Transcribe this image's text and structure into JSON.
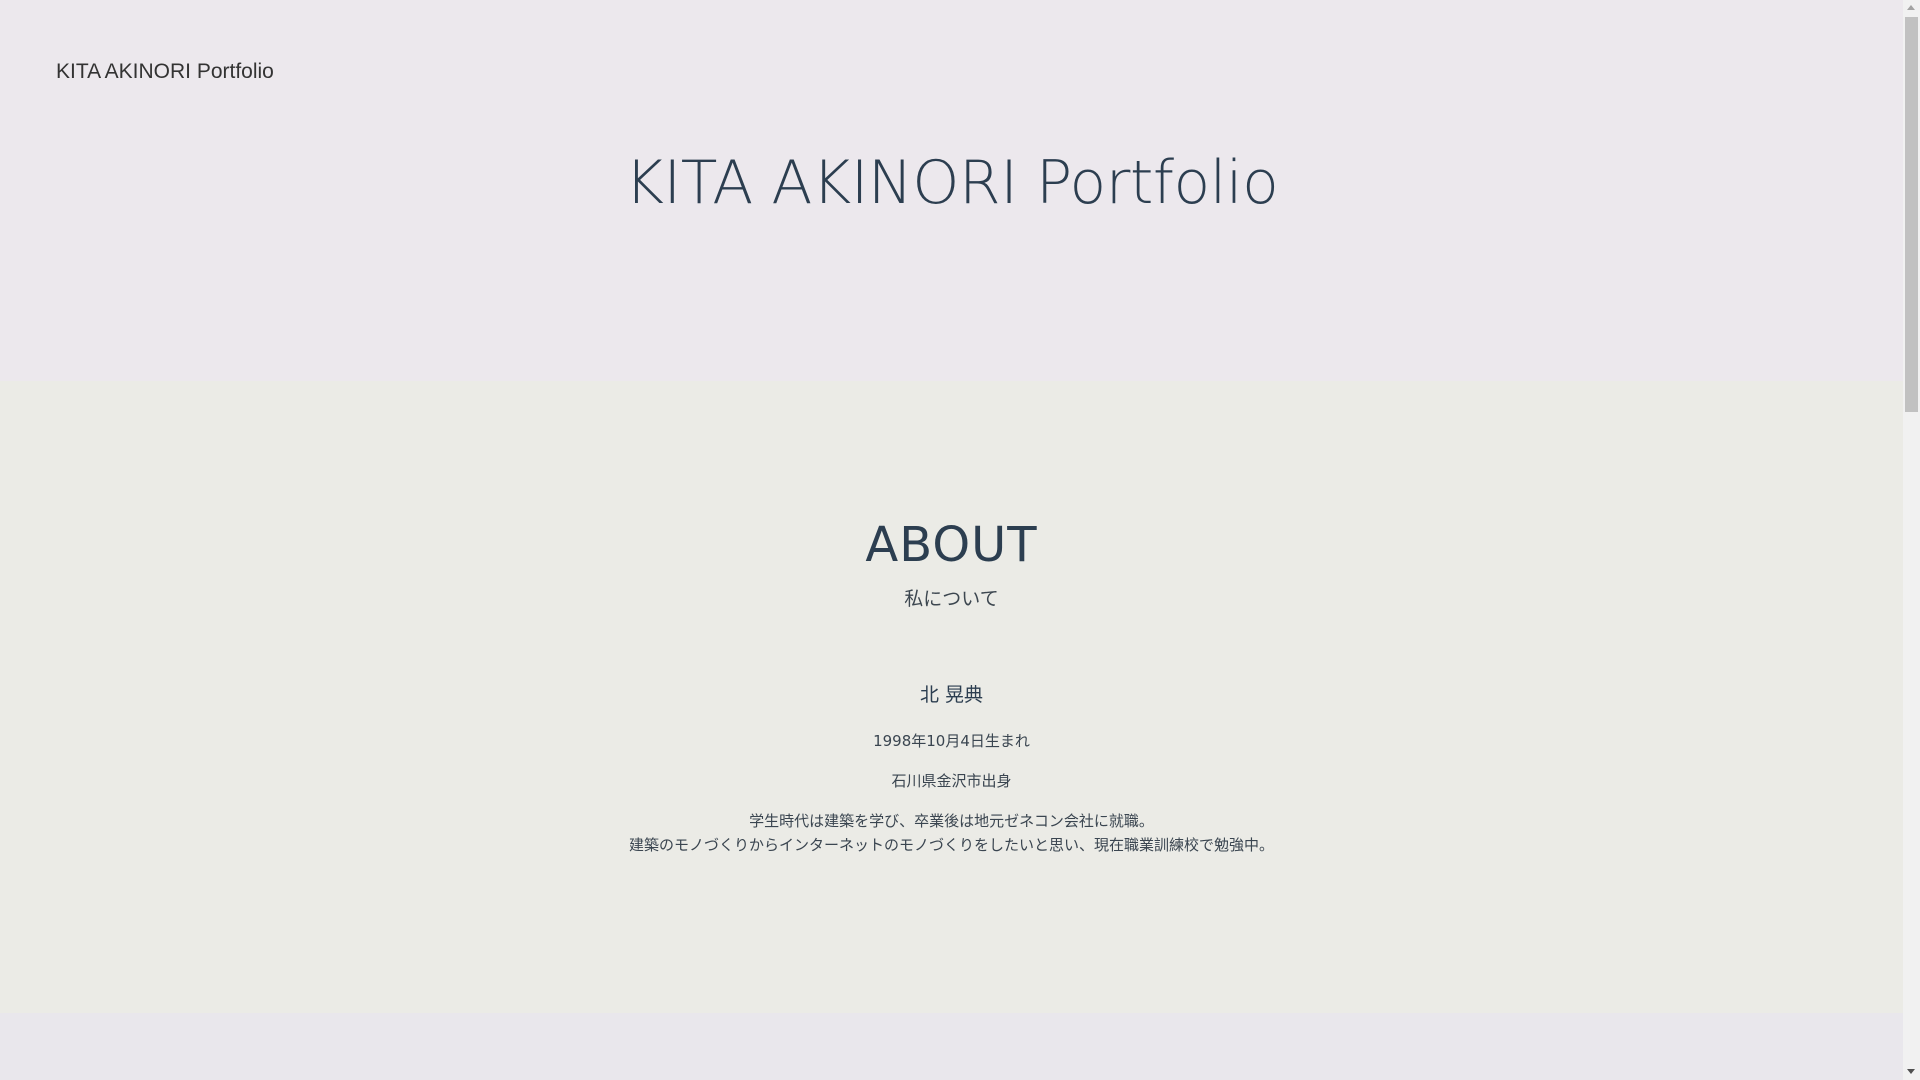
{
  "header": {
    "logo": "KITA AKINORI Portfolio"
  },
  "hero": {
    "title": "KITA AKINORI Portfolio"
  },
  "about": {
    "heading": "ABOUT",
    "subheading": "私について",
    "name": "北 晃典",
    "birth": "1998年10月4日生まれ",
    "hometown": "石川県金沢市出身",
    "bio_line1": "学生時代は建築を学び、卒業後は地元ゼネコン会社に就職。",
    "bio_line2": "建築のモノづくりからインターネットのモノづくりをしたいと思い、現在職業訓練校で勉強中。"
  },
  "scrollbar": {
    "up_icon": "triangle-up",
    "down_icon": "triangle-down"
  },
  "colors": {
    "hero_bg": "#ece8ed",
    "about_bg": "#ebebe6",
    "next_bg": "#e9e7ec",
    "text": "#2c3e50"
  }
}
